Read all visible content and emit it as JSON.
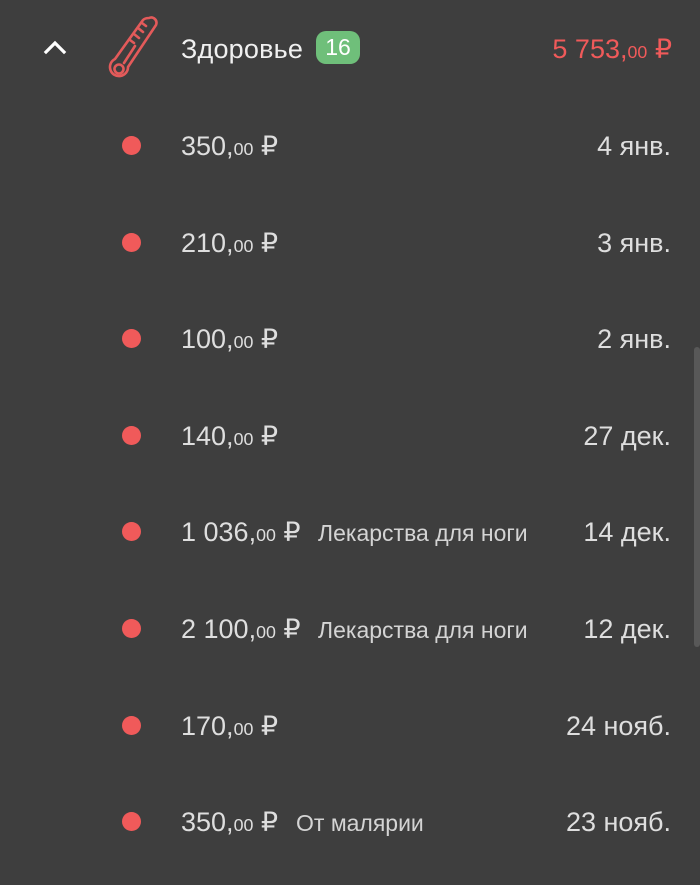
{
  "category": {
    "icon": "thermometer-icon",
    "title": "Здоровье",
    "count": "16",
    "total_main": "5 753,",
    "total_cents": "00",
    "total_currency": " ₽"
  },
  "colors": {
    "background": "#3e3e3e",
    "expense_red": "#f05a5a",
    "badge_green": "#6fbf7a",
    "text": "#dedede"
  },
  "expenses": [
    {
      "amount_main": "350,",
      "amount_cents": "00",
      "currency": " ₽",
      "note": "",
      "date": "4 янв."
    },
    {
      "amount_main": "210,",
      "amount_cents": "00",
      "currency": " ₽",
      "note": "",
      "date": "3 янв."
    },
    {
      "amount_main": "100,",
      "amount_cents": "00",
      "currency": " ₽",
      "note": "",
      "date": "2 янв."
    },
    {
      "amount_main": "140,",
      "amount_cents": "00",
      "currency": " ₽",
      "note": "",
      "date": "27 дек."
    },
    {
      "amount_main": "1 036,",
      "amount_cents": "00",
      "currency": " ₽",
      "note": "Лекарства для ноги",
      "date": "14 дек."
    },
    {
      "amount_main": "2 100,",
      "amount_cents": "00",
      "currency": " ₽",
      "note": "Лекарства для ноги",
      "date": "12 дек."
    },
    {
      "amount_main": "170,",
      "amount_cents": "00",
      "currency": " ₽",
      "note": "",
      "date": "24 нояб."
    },
    {
      "amount_main": "350,",
      "amount_cents": "00",
      "currency": " ₽",
      "note": "От малярии",
      "date": "23 нояб."
    }
  ]
}
